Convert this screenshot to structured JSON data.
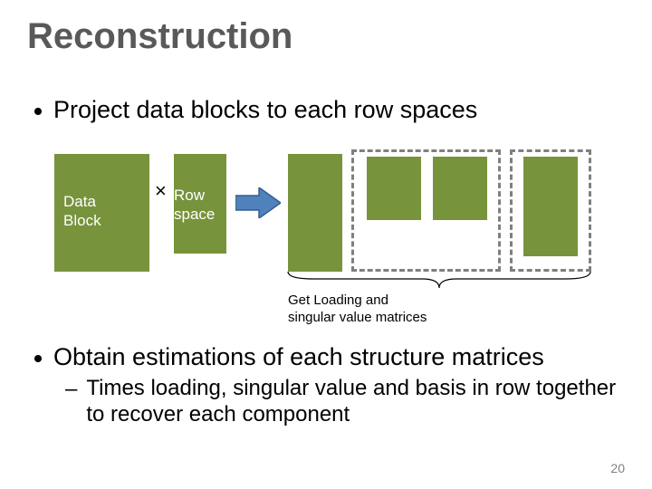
{
  "title": "Reconstruction",
  "bullets": {
    "b1": "Project data blocks to each row spaces",
    "b2": "Obtain estimations of each structure matrices",
    "sub1": "Times loading, singular value and basis in row together to recover each component"
  },
  "diagram": {
    "data_block": "Data\nBlock",
    "times": "×",
    "row_space": "Row\nspace",
    "brace_label": "Get Loading and\nsingular value matrices"
  },
  "page_number": "20"
}
